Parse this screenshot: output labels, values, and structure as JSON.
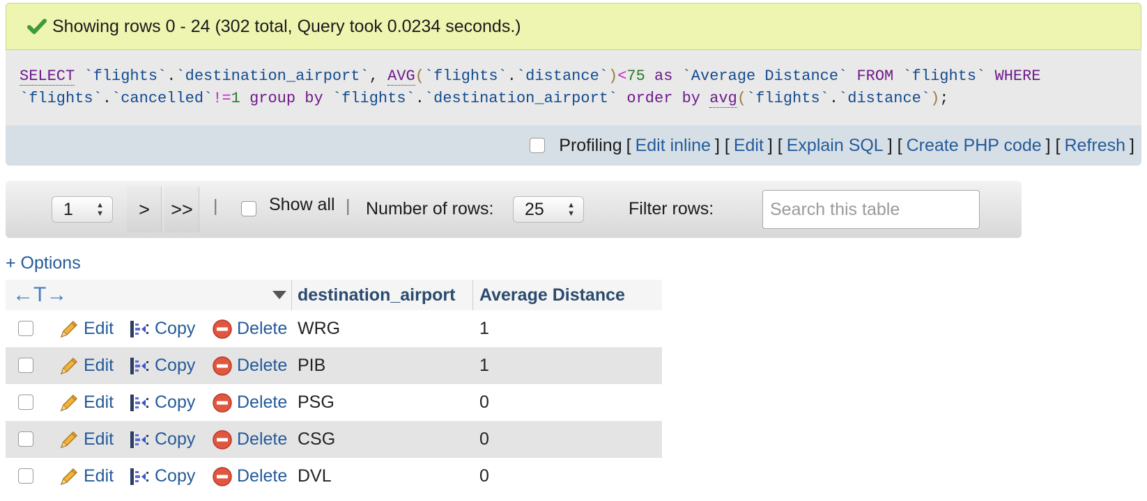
{
  "status": {
    "icon": "check-icon",
    "message": "Showing rows 0 - 24 (302 total, Query took 0.0234 seconds.)"
  },
  "sql": {
    "line1": "SELECT `flights`.`destination_airport`, AVG(`flights`.`distance`)<75 as `Average Distance` FROM `flights` WHERE",
    "line2": "`flights`.`cancelled`!=1 group by `flights`.`destination_airport` order by avg(`flights`.`distance`);"
  },
  "query_actions": {
    "profiling_label": "Profiling",
    "links": [
      "Edit inline",
      "Edit",
      "Explain SQL",
      "Create PHP code",
      "Refresh"
    ]
  },
  "navigation": {
    "page_value": "1",
    "next_label": ">",
    "last_label": ">>",
    "separator": "|",
    "show_all_label": "Show all",
    "rows_label": "Number of rows:",
    "rows_value": "25",
    "filter_label": "Filter rows:",
    "filter_placeholder": "Search this table"
  },
  "options_label": "+ Options",
  "table": {
    "arrows_glyph": "←T→",
    "columns": [
      "destination_airport",
      "Average Distance"
    ],
    "action_labels": {
      "edit": "Edit",
      "copy": "Copy",
      "delete": "Delete"
    },
    "rows": [
      {
        "destination_airport": "WRG",
        "average_distance": "1"
      },
      {
        "destination_airport": "PIB",
        "average_distance": "1"
      },
      {
        "destination_airport": "PSG",
        "average_distance": "0"
      },
      {
        "destination_airport": "CSG",
        "average_distance": "0"
      },
      {
        "destination_airport": "DVL",
        "average_distance": "0"
      }
    ]
  },
  "colors": {
    "success_bg": "#eef5b1",
    "sql_bg": "#e9e9e9",
    "link": "#235a9a",
    "header_text": "#2a4a6e"
  }
}
